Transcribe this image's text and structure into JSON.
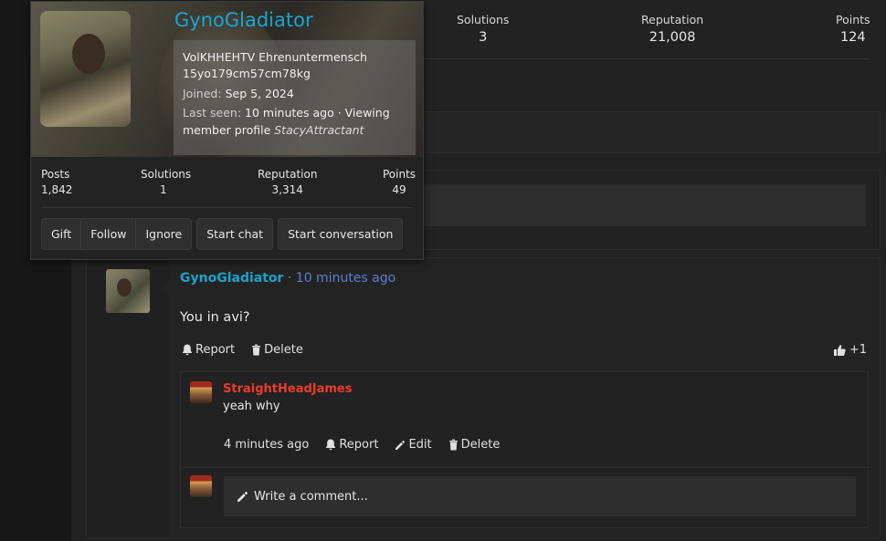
{
  "popup": {
    "username": "GynoGladiator",
    "title_line1": "VolKHHEHTV Ehrenuntermensch",
    "title_line2": "15yo179cm57cm78kg",
    "joined_label": "Joined:",
    "joined_value": "Sep 5, 2024",
    "last_seen_label": "Last seen:",
    "last_seen_value": "10 minutes ago · Viewing",
    "last_seen_value2": "member profile",
    "last_seen_target": "StacyAttractant",
    "stats": [
      {
        "label": "Posts",
        "value": "1,842"
      },
      {
        "label": "Solutions",
        "value": "1"
      },
      {
        "label": "Reputation",
        "value": "3,314"
      },
      {
        "label": "Points",
        "value": "49"
      }
    ],
    "buttons": {
      "gift": "Gift",
      "follow": "Follow",
      "ignore": "Ignore",
      "start_chat": "Start chat",
      "start_conversation": "Start conversation"
    }
  },
  "profile_stats": [
    {
      "label": "Solutions",
      "value": "3"
    },
    {
      "label": "Reputation",
      "value": "21,008"
    },
    {
      "label": "Points",
      "value": "124"
    }
  ],
  "post": {
    "author": "GynoGladiator",
    "separator": "·",
    "time": "10 minutes ago",
    "body": "You in avi?",
    "report": "Report",
    "delete": "Delete",
    "likes": "+1"
  },
  "comment": {
    "author": "StraightHeadJames",
    "text": "yeah why",
    "time": "4 minutes ago",
    "report": "Report",
    "edit": "Edit",
    "delete": "Delete"
  },
  "write_comment": "Write a comment...",
  "colors": {
    "username_blue": "#17a8d1",
    "time_link": "#5b7fd1",
    "comment_author_red": "#ea3b2c"
  }
}
